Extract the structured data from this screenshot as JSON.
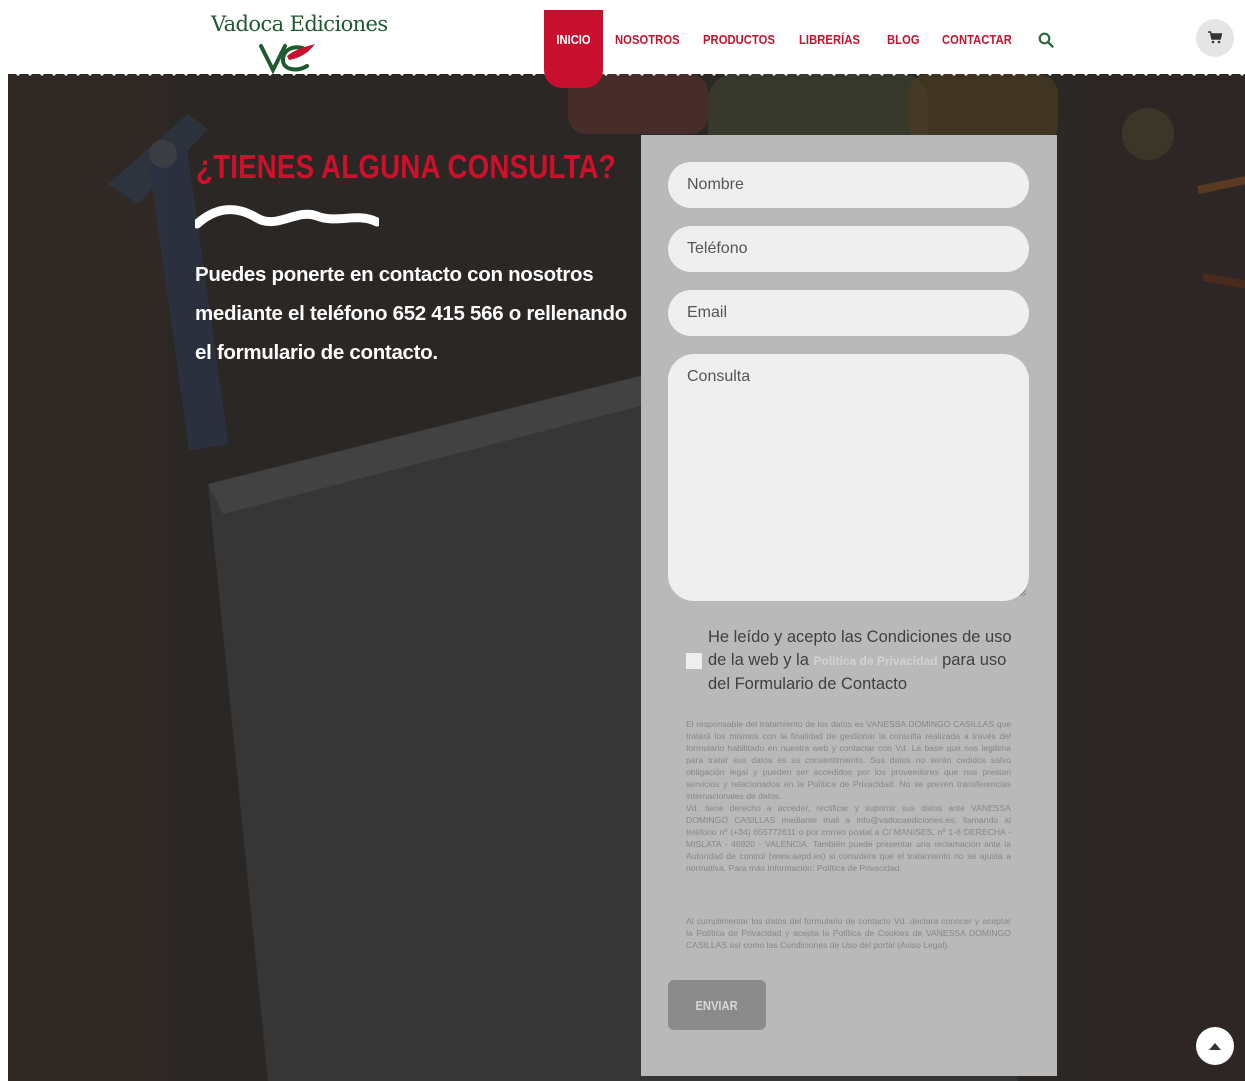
{
  "brand": {
    "logo_text": "Vadoca Ediciones"
  },
  "nav": {
    "items": [
      {
        "label": "INICIO",
        "active": true
      },
      {
        "label": "NOSOTROS"
      },
      {
        "label": "PRODUCTOS"
      },
      {
        "label": "LIBRERÍAS"
      },
      {
        "label": "BLOG"
      },
      {
        "label": "CONTACTAR"
      }
    ],
    "search_icon": "search-icon",
    "cart_icon": "cart-icon"
  },
  "colors": {
    "accent": "#c8102e",
    "panel": "#b9b9b9",
    "field": "#efefef",
    "background": "#2b2725"
  },
  "hero": {
    "heading": "¿TIENES ALGUNA CONSULTA?",
    "lead": "Puedes ponerte en contacto con nosotros mediante el teléfono 652 415 566 o rellenando el formulario de contacto."
  },
  "form": {
    "name_placeholder": "Nombre",
    "phone_placeholder": "Teléfono",
    "email_placeholder": "Email",
    "message_placeholder": "Consulta",
    "consent_before": "He leído y acepto las Condiciones de uso de la web y la ",
    "consent_link": "Política de Privacidad",
    "consent_after": " para uso del Formulario de Contacto",
    "legal_1": "El responsable del tratamiento de los datos es VANESSA DOMINGO CASILLAS que tratará los mismos con la finalidad de gestionar la consulta realizada a través del formulario habilitado en nuestra web y contactar con Vd. La base que nos legitima para tratar sus datos es su consentimiento. Sus datos no serán cedidos salvo obligación legal y pueden ser accedidos por los proveedores que nos prestan servicios y relacionados en la Política de Privacidad. No se prevén transferencias internacionales de datos.",
    "legal_2": "Vd. tiene derecho a acceder, rectificar y suprimir sus datos ante VANESSA DOMINGO CASILLAS mediante mail a info@vadocaediciones.es, llamando al teléfono nº (+34) 655772611 o por correo postal a C/ MANISES, nº 1-8 DERECHA - MISLATA - 46920 - VALENCIA. También puede presentar una reclamación ante la Autoridad de control (www.aepd.es) si considera que el tratamiento no se ajusta a normativa. Para más información: Política de Privacidad.",
    "legal_3": "Al cumplimentar los datos del formulario de contacto Vd. declara conocer y aceptar la Política de Privacidad y acepta la Política de Cookies de VANESSA DOMINGO CASILLAS así como las Condiciones de Uso del portal (Aviso Legal).",
    "submit_label": "ENVIAR"
  },
  "back_to_top_icon": "chevron-up-icon"
}
